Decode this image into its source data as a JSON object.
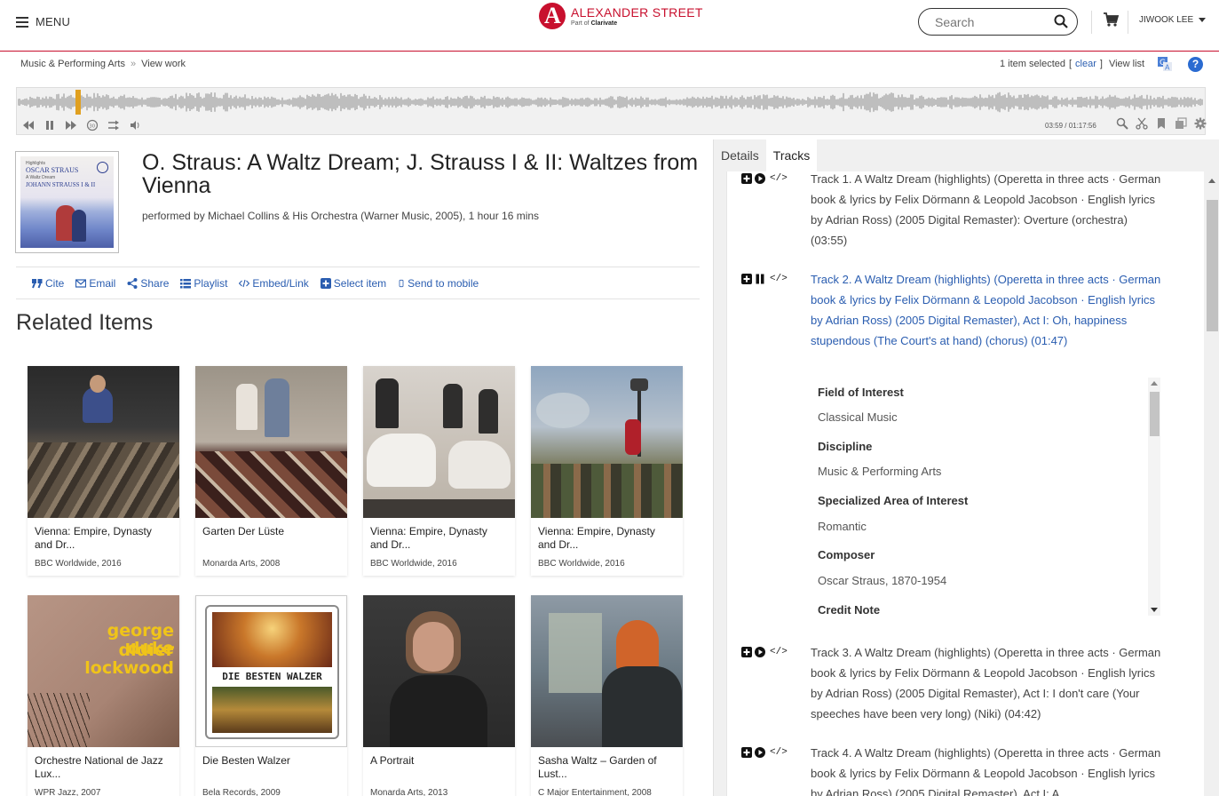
{
  "header": {
    "menu_label": "MENU",
    "logo_name": "ALEXANDER STREET",
    "logo_sub_prefix": "Part of",
    "logo_sub_brand": "Clarivate",
    "search_placeholder": "Search",
    "user_name": "JIWOOK LEE"
  },
  "breadcrumb": {
    "items": [
      "Music & Performing Arts",
      "View work"
    ],
    "separator": "»"
  },
  "selection": {
    "count_text": "1 item selected",
    "open_bracket": "[",
    "clear": "clear",
    "close_bracket": "]",
    "view_list": "View list"
  },
  "player": {
    "time": "03:59 / 01:17:56",
    "progress_fraction": 0.051
  },
  "work": {
    "cover": {
      "line1": "Highlights",
      "line2": "OSCAR STRAUS",
      "line3": "A Waltz Dream",
      "line4": "JOHANN STRAUSS I & II"
    },
    "title": "O. Straus: A Waltz Dream; J. Strauss I & II: Waltzes from Vienna",
    "performed": "performed by Michael Collins & His Orchestra (Warner Music, 2005), 1 hour 16 mins"
  },
  "actions": [
    {
      "label": "Cite",
      "icon": "quote-icon"
    },
    {
      "label": "Email",
      "icon": "envelope-icon"
    },
    {
      "label": "Share",
      "icon": "share-icon"
    },
    {
      "label": "Playlist",
      "icon": "list-icon"
    },
    {
      "label": "Embed/Link",
      "icon": "code-icon"
    },
    {
      "label": "Select item",
      "icon": "plus-square-icon"
    },
    {
      "label": "Send to mobile",
      "icon": "mobile-icon"
    }
  ],
  "related": {
    "heading": "Related Items",
    "cards": [
      {
        "title": "Vienna: Empire, Dynasty and Dr...",
        "meta": "BBC Worldwide, 2016"
      },
      {
        "title": "Garten Der Lüste",
        "meta": "Monarda Arts, 2008"
      },
      {
        "title": "Vienna: Empire, Dynasty and Dr...",
        "meta": "BBC Worldwide, 2016"
      },
      {
        "title": "Vienna: Empire, Dynasty and Dr...",
        "meta": "BBC Worldwide, 2016"
      },
      {
        "title": "Orchestre National de Jazz Lux...",
        "meta": "WPR Jazz, 2007",
        "thumb_line1": "george duke",
        "thumb_line2": "didier lockwood"
      },
      {
        "title": "Die Besten Walzer",
        "meta": "Bela Records, 2009",
        "thumb_line1": "DIE BESTEN WALZER"
      },
      {
        "title": "A Portrait",
        "meta": "Monarda Arts, 2013"
      },
      {
        "title": "Sasha Waltz – Garden of Lust...",
        "meta": "C Major Entertainment, 2008"
      }
    ]
  },
  "panel": {
    "tabs": [
      "Details",
      "Tracks"
    ],
    "active_tab": "Tracks",
    "embed_glyph": "</>",
    "tracks": [
      {
        "text": "Track 1. A Waltz Dream (highlights) (Operetta in three acts · German book & lyrics by Felix Dörmann & Leopold Jacobson · English lyrics by Adrian Ross) (2005 Digital Remaster): Overture (orchestra) (03:55)"
      },
      {
        "text": "Track 2. A Waltz Dream (highlights) (Operetta in three acts · German book & lyrics by Felix Dörmann & Leopold Jacobson · English lyrics by Adrian Ross) (2005 Digital Remaster), Act I: Oh, happiness stupendous (The Court's at hand) (chorus) (01:47)"
      },
      {
        "text": "Track 3. A Waltz Dream (highlights) (Operetta in three acts · German book & lyrics by Felix Dörmann & Leopold Jacobson · English lyrics by Adrian Ross) (2005 Digital Remaster), Act I: I don't care (Your speeches have been very long) (Niki) (04:42)"
      },
      {
        "text": "Track 4. A Waltz Dream (highlights) (Operetta in three acts · German book & lyrics by Felix Dörmann & Leopold Jacobson · English lyrics by Adrian Ross) (2005 Digital Remaster), Act I: A"
      }
    ],
    "details": [
      {
        "label": "Field of Interest",
        "value": "Classical Music"
      },
      {
        "label": "Discipline",
        "value": "Music & Performing Arts"
      },
      {
        "label": "Specialized Area of Interest",
        "value": "Romantic"
      },
      {
        "label": "Composer",
        "value": "Oscar Straus, 1870-1954"
      },
      {
        "label": "Credit Note",
        "value": ""
      }
    ]
  }
}
